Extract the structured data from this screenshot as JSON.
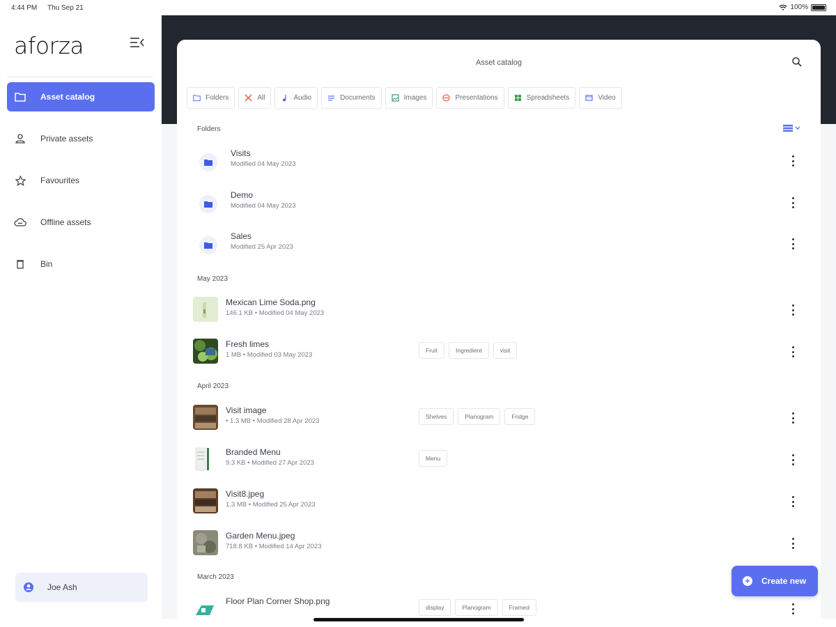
{
  "status_bar": {
    "time": "4:44 PM",
    "date": "Thu Sep 21",
    "battery": "100%"
  },
  "sidebar": {
    "logo": "aforza",
    "items": [
      {
        "label": "Asset catalog",
        "icon": "folder-icon",
        "active": true
      },
      {
        "label": "Private assets",
        "icon": "person-icon",
        "active": false
      },
      {
        "label": "Favourites",
        "icon": "star-icon",
        "active": false
      },
      {
        "label": "Offline assets",
        "icon": "cloud-offline-icon",
        "active": false
      },
      {
        "label": "Bin",
        "icon": "trash-icon",
        "active": false
      }
    ],
    "user": {
      "name": "Joe Ash",
      "icon": "account-icon"
    }
  },
  "main": {
    "title": "Asset catalog",
    "filters": [
      {
        "label": "Folders",
        "icon": "folder-icon",
        "color": "#5a6ff0"
      },
      {
        "label": "All",
        "icon": "x-icon",
        "color": "#e45a3a"
      },
      {
        "label": "Audio",
        "icon": "music-icon",
        "color": "#7a4fd6"
      },
      {
        "label": "Documents",
        "icon": "document-icon",
        "color": "#5a6ff0"
      },
      {
        "label": "Images",
        "icon": "image-icon",
        "color": "#3a9a6a"
      },
      {
        "label": "Presentations",
        "icon": "presentation-icon",
        "color": "#e45a3a"
      },
      {
        "label": "Spreadsheets",
        "icon": "spreadsheet-icon",
        "color": "#3a9a4a"
      },
      {
        "label": "Video",
        "icon": "video-icon",
        "color": "#5a6ff0"
      }
    ],
    "sections": {
      "folders": "Folders",
      "may": "May 2023",
      "april": "April 2023",
      "march": "March 2023"
    },
    "folders": [
      {
        "name": "Visits",
        "meta": "Modified 04 May 2023"
      },
      {
        "name": "Demo",
        "meta": "Modified 04 May 2023"
      },
      {
        "name": "Sales",
        "meta": "Modified 25 Apr 2023"
      }
    ],
    "may_files": [
      {
        "name": "Mexican Lime Soda.png",
        "meta": "146.1 KB • Modified 04 May 2023",
        "tags": []
      },
      {
        "name": "Fresh limes",
        "meta": "1 MB • Modified 03 May 2023",
        "tags": [
          "Fruit",
          "Ingredient",
          "visit"
        ]
      }
    ],
    "april_files": [
      {
        "name": "Visit image",
        "meta": "• 1.3 MB • Modified 28 Apr 2023",
        "tags": [
          "Shelves",
          "Planogram",
          "Fridge"
        ]
      },
      {
        "name": "Branded Menu",
        "meta": "9.3 KB • Modified 27 Apr 2023",
        "tags": [
          "Menu"
        ]
      },
      {
        "name": "Visit8.jpeg",
        "meta": "1.3 MB • Modified 25 Apr 2023",
        "tags": []
      },
      {
        "name": "Garden Menu.jpeg",
        "meta": "718.8 KB • Modified 14 Apr 2023",
        "tags": []
      }
    ],
    "march_files": [
      {
        "name": "Floor Plan Corner Shop.png",
        "meta": "",
        "tags": [
          "display",
          "Planogram",
          "Framed"
        ]
      }
    ],
    "create_button": "Create new"
  },
  "colors": {
    "accent": "#5a6ff0",
    "dark_band": "#22262e"
  }
}
